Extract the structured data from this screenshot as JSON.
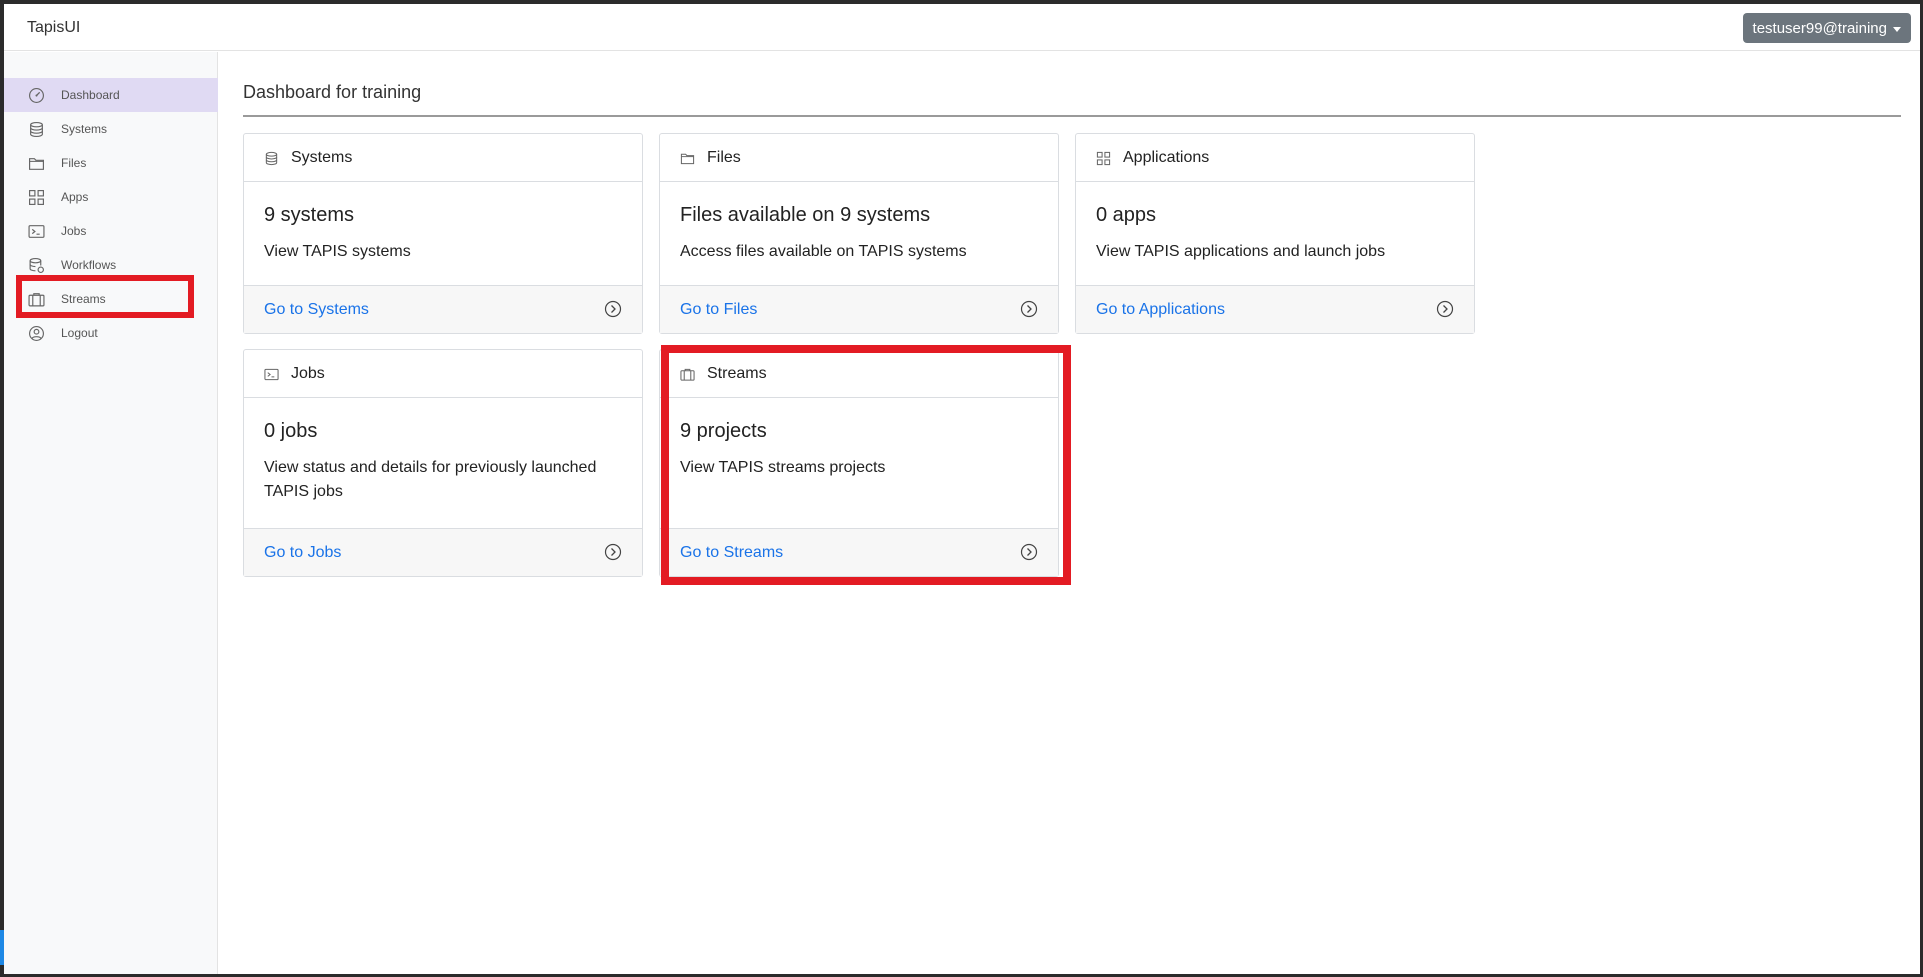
{
  "app": {
    "brand": "TapisUI",
    "user_menu": "testuser99@training"
  },
  "sidebar": {
    "items": [
      {
        "label": "Dashboard",
        "icon": "dashboard-icon",
        "active": true
      },
      {
        "label": "Systems",
        "icon": "database-icon",
        "active": false
      },
      {
        "label": "Files",
        "icon": "folder-icon",
        "active": false
      },
      {
        "label": "Apps",
        "icon": "grid-icon",
        "active": false
      },
      {
        "label": "Jobs",
        "icon": "terminal-icon",
        "active": false
      },
      {
        "label": "Workflows",
        "icon": "workflow-icon",
        "active": false
      },
      {
        "label": "Streams",
        "icon": "briefcase-icon",
        "active": false
      },
      {
        "label": "Logout",
        "icon": "user-circle-icon",
        "active": false
      }
    ]
  },
  "main": {
    "title": "Dashboard for training",
    "cards": [
      {
        "title": "Systems",
        "icon": "database-icon",
        "count": "9 systems",
        "description": "View TAPIS systems",
        "link": "Go to Systems"
      },
      {
        "title": "Files",
        "icon": "folder-icon",
        "count": "Files available on 9 systems",
        "description": "Access files available on TAPIS systems",
        "link": "Go to Files"
      },
      {
        "title": "Applications",
        "icon": "grid-icon",
        "count": "0 apps",
        "description": "View TAPIS applications and launch jobs",
        "link": "Go to Applications"
      },
      {
        "title": "Jobs",
        "icon": "terminal-icon",
        "count": "0 jobs",
        "description": "View status and details for previously launched TAPIS jobs",
        "link": "Go to Jobs"
      },
      {
        "title": "Streams",
        "icon": "briefcase-icon",
        "count": "9 projects",
        "description": "View TAPIS streams projects",
        "link": "Go to Streams"
      }
    ]
  },
  "colors": {
    "highlight": "#e31b23",
    "link": "#1a73e8",
    "active_nav": "#e0daf3"
  }
}
